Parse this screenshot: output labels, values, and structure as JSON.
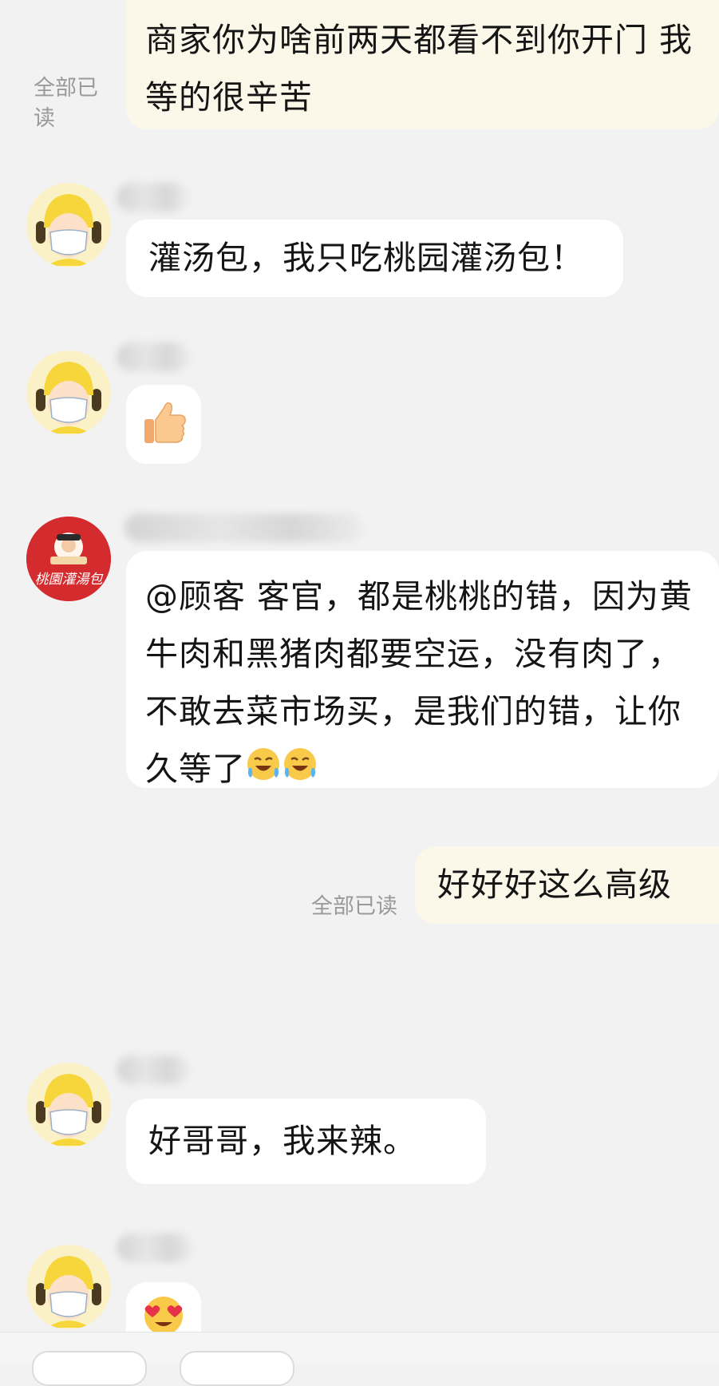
{
  "messages": {
    "m1": {
      "text": "商家你为啥前两天都看不到你开门 我等的很辛苦",
      "read_status": "全部已读"
    },
    "m2": {
      "text": "灌汤包，我只吃桃园灌汤包！"
    },
    "m3": {
      "emoji": "thumbs-up"
    },
    "m4": {
      "text": "@顾客 客官，都是桃桃的错，因为黄牛肉和黑猪肉都要空运，没有肉了，不敢去菜市场买，是我们的错，让你久等了"
    },
    "m5": {
      "text": "好好好这么高级",
      "read_status": "全部已读"
    },
    "m6": {
      "text": "好哥哥，我来辣。"
    },
    "m7": {
      "emoji": "heart-eyes"
    }
  },
  "merchant_logo_text": "桃園灌湯包",
  "colors": {
    "background": "#f2f2f2",
    "incoming_bubble": "#ffffff",
    "outgoing_bubble": "#fcf8e9",
    "read_text": "#9a9a9a",
    "rider_yellow": "#f7d63c",
    "merchant_red": "#d42b2f"
  }
}
